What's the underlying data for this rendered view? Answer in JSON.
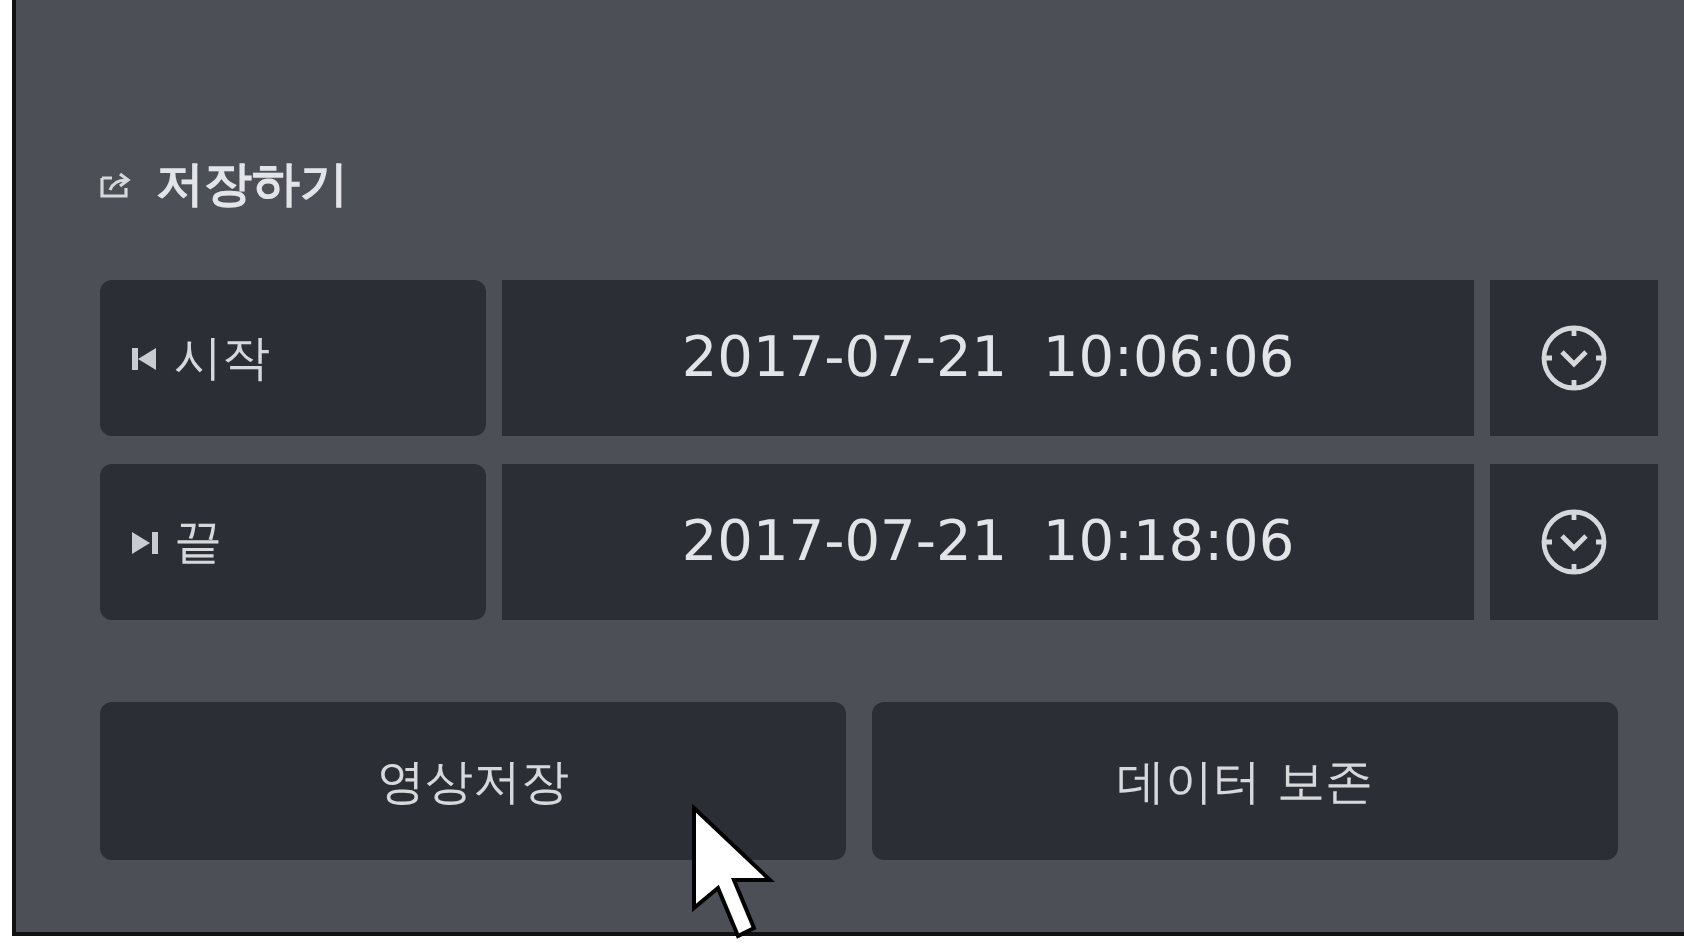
{
  "panel": {
    "title": "저장하기"
  },
  "time_rows": [
    {
      "kind": "start",
      "label": "시작",
      "value": "2017-07-21  10:06:06"
    },
    {
      "kind": "end",
      "label": "끝",
      "value": "2017-07-21  10:18:06"
    }
  ],
  "buttons": [
    "영상저장",
    "데이터 보존"
  ]
}
